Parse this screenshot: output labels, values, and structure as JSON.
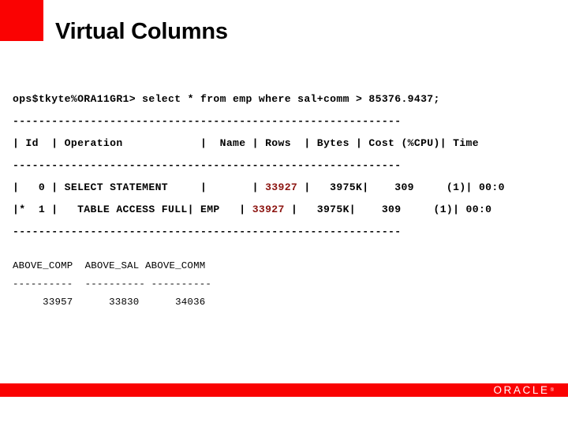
{
  "slide": {
    "title": "Virtual Columns",
    "accent_color": "#fa0202",
    "background_color": "#ffffff"
  },
  "terminal": {
    "prompt_line": "ops$tkyte%ORA11GR1> select * from emp where sal+comm > 85376.9437;",
    "separator_top": "------------------------------------------------------------",
    "header_left": "| Id  | Operation            |  Name | ",
    "header_rows": "Rows",
    "header_right": "  | Bytes | Cost (%CPU)| Time",
    "separator_mid": "------------------------------------------------------------",
    "row0_left": "|   0 | SELECT STATEMENT     |       | ",
    "row0_rows": "33927",
    "row0_right": " |   3975K|    309     (1)| 00:0",
    "row1_left": "|*  1 |   TABLE ACCESS FULL| EMP   | ",
    "row1_rows": "33927",
    "row1_right": " |   3975K|    309     (1)| 00:0",
    "separator_bottom": "------------------------------------------------------------",
    "hot_value_color": "#8c1410"
  },
  "result_set": {
    "header": "ABOVE_COMP  ABOVE_SAL ABOVE_COMM",
    "underline": "----------  ---------- ----------",
    "values_row": "     33957      33830      34036",
    "columns": [
      "ABOVE_COMP",
      "ABOVE_SAL",
      "ABOVE_COMM"
    ],
    "values": [
      33957,
      33830,
      34036
    ]
  },
  "plan_table": {
    "columns": [
      "Id",
      "Operation",
      "Name",
      "Rows",
      "Bytes",
      "Cost (%CPU)",
      "Time"
    ],
    "rows": [
      {
        "id": "0",
        "operation": "SELECT STATEMENT",
        "name": "",
        "rows": "33927",
        "bytes": "3975K",
        "cost": "309",
        "cpu": "(1)",
        "time": "00:0"
      },
      {
        "id": "1",
        "id_marker": "*",
        "operation": "TABLE ACCESS FULL",
        "name": "EMP",
        "rows": "33927",
        "bytes": "3975K",
        "cost": "309",
        "cpu": "(1)",
        "time": "00:0"
      }
    ]
  },
  "footer": {
    "band_color": "#fa0202",
    "logo_text": "ORACLE",
    "logo_trademark": "®"
  }
}
